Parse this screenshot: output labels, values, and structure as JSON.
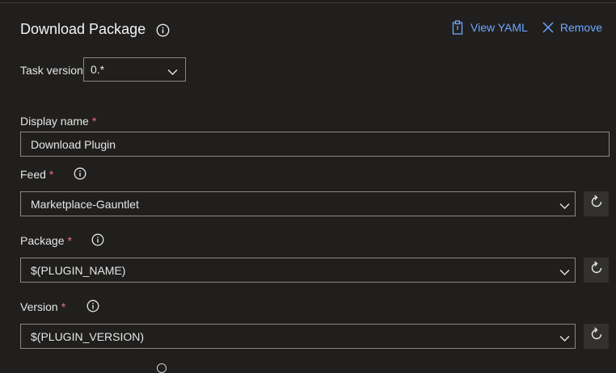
{
  "header": {
    "title": "Download Package",
    "view_yaml_label": "View YAML",
    "remove_label": "Remove"
  },
  "task_version": {
    "label": "Task version",
    "value": "0.*"
  },
  "fields": {
    "display_name": {
      "label": "Display name",
      "required": "*",
      "value": "Download Plugin"
    },
    "feed": {
      "label": "Feed",
      "required": "*",
      "value": "Marketplace-Gauntlet"
    },
    "package": {
      "label": "Package",
      "required": "*",
      "value": "$(PLUGIN_NAME)"
    },
    "version": {
      "label": "Version",
      "required": "*",
      "value": "$(PLUGIN_VERSION)"
    }
  },
  "colors": {
    "background": "#201f1e",
    "accent_link": "#6ea8ff",
    "required": "#f1707b",
    "border": "#8a8886"
  }
}
